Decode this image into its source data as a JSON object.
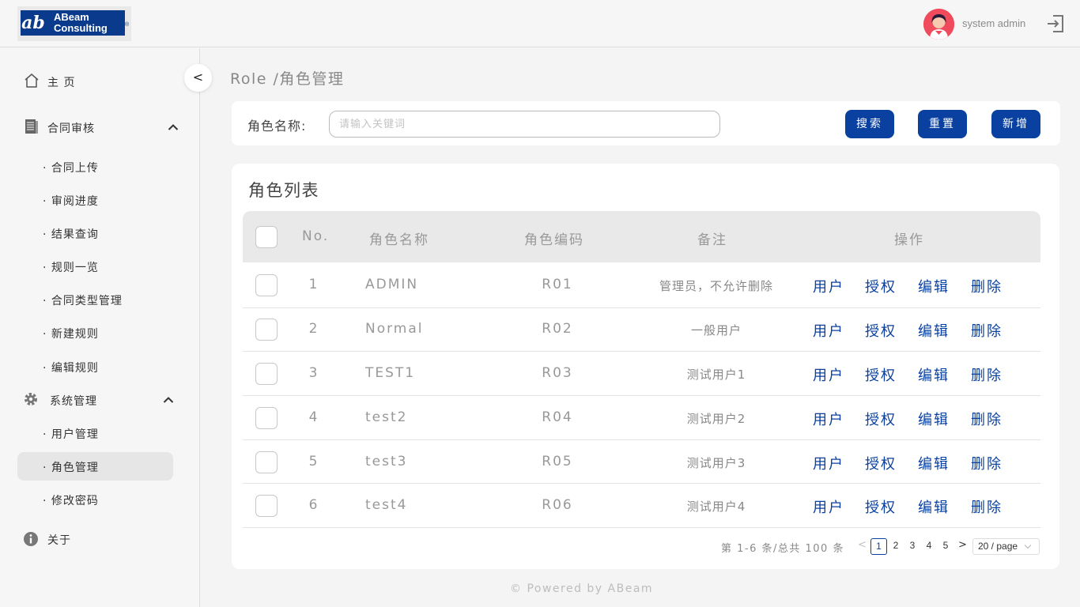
{
  "header": {
    "logo_line1": "ABeam",
    "logo_line2": "Consulting",
    "logo_reg": "®",
    "username": "system admin"
  },
  "sidebar": {
    "collapse_label": "<",
    "home": "主 页",
    "contract_review": "合同审核",
    "contract_items": [
      "合同上传",
      "审阅进度",
      "结果查询",
      "规则一览",
      "合同类型管理",
      "新建规则",
      "编辑规则"
    ],
    "system_mgmt": "系统管理",
    "system_items": [
      "用户管理",
      "角色管理",
      "修改密码"
    ],
    "about": "关于",
    "bullet": "·"
  },
  "breadcrumb": "Role /角色管理",
  "search": {
    "label": "角色名称:",
    "placeholder": "请输入关键词",
    "value": "",
    "search_btn": "搜索",
    "reset_btn": "重置",
    "add_btn": "新增"
  },
  "list": {
    "title": "角色列表",
    "columns": {
      "no": "No.",
      "name": "角色名称",
      "code": "角色编码",
      "note": "备注",
      "ops": "操作"
    },
    "rows": [
      {
        "no": "1",
        "name": "ADMIN",
        "code": "R01",
        "note": "管理员，不允许删除"
      },
      {
        "no": "2",
        "name": "Normal",
        "code": "R02",
        "note": "一般用户"
      },
      {
        "no": "3",
        "name": "TEST1",
        "code": "R03",
        "note": "测试用户1"
      },
      {
        "no": "4",
        "name": "test2",
        "code": "R04",
        "note": "测试用户2"
      },
      {
        "no": "5",
        "name": "test3",
        "code": "R05",
        "note": "测试用户3"
      },
      {
        "no": "6",
        "name": "test4",
        "code": "R06",
        "note": "测试用户4"
      }
    ],
    "ops": {
      "users": "用户",
      "auth": "授权",
      "edit": "编辑",
      "delete": "删除"
    }
  },
  "pagination": {
    "total_text": "第 1-6 条/总共 100 条",
    "prev": "<",
    "next": ">",
    "current": "1",
    "pages": [
      "2",
      "3",
      "4",
      "5"
    ],
    "page_size": "20 / page"
  },
  "footer": "© Powered by ABeam",
  "colors": {
    "primary": "#0a40a0",
    "avatar": "#ef4b5c"
  }
}
